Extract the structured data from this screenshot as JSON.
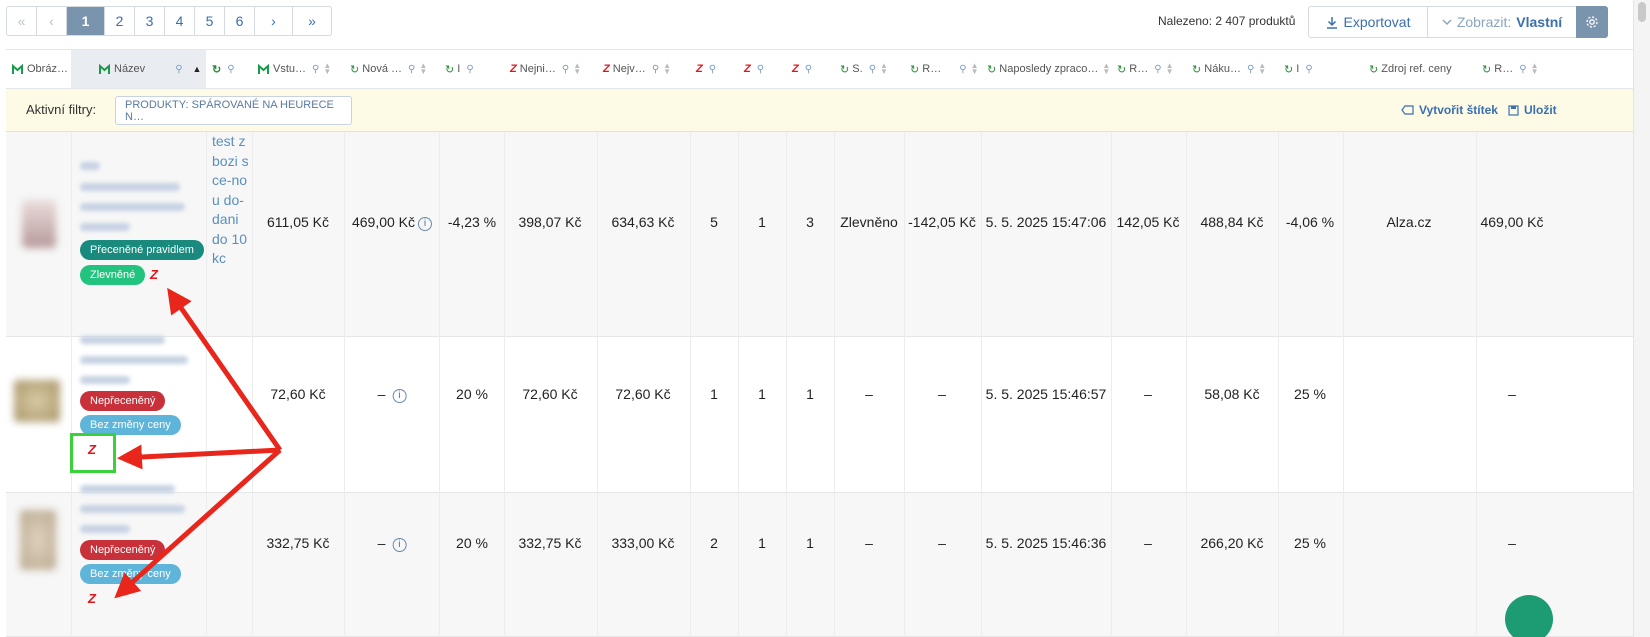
{
  "pagination": {
    "first": "«",
    "prev": "‹",
    "pages": [
      "1",
      "2",
      "3",
      "4",
      "5",
      "6"
    ],
    "next": "›",
    "last": "»",
    "current": "1"
  },
  "toolbar": {
    "found": "Nalezeno: 2 407 produktů",
    "export_label": "Exportovat",
    "view_prefix": "Zobrazit:",
    "view_value": "Vlastní"
  },
  "columns": [
    "Obráz…",
    "Název",
    "",
    "Vstu…",
    "Nová …",
    "I",
    "Nejni…",
    "Nejv…",
    "",
    "",
    "",
    "S.",
    "R…",
    "Naposledy zpraco…",
    "R…",
    "Náku…",
    "I",
    "Zdroj ref. ceny",
    "R…"
  ],
  "filters": {
    "label": "Aktivní filtry:",
    "chip": "PRODUKTY: SPÁROVANÉ NA HEURECE N…",
    "create_tag": "Vytvořit štítek",
    "save": "Uložit"
  },
  "rows": [
    {
      "tags": [
        "Přeceněné pravidlem",
        "Zlevněné"
      ],
      "note": "test zbozi s ce-nou do-dani do 10 kc",
      "cells": [
        "611,05 Kč",
        "469,00 Kč",
        "-4,23 %",
        "398,07 Kč",
        "634,63 Kč",
        "5",
        "1",
        "3",
        "Zlevněno",
        "-142,05 Kč",
        "5. 5. 2025 15:47:06",
        "142,05 Kč",
        "488,84 Kč",
        "-4,06 %",
        "Alza.cz",
        "469,00 Kč"
      ]
    },
    {
      "tags": [
        "Nepřeceněný",
        "Bez změny ceny"
      ],
      "note": "",
      "cells": [
        "72,60 Kč",
        "–",
        "20 %",
        "72,60 Kč",
        "72,60 Kč",
        "1",
        "1",
        "1",
        "–",
        "–",
        "5. 5. 2025 15:46:57",
        "–",
        "58,08 Kč",
        "25 %",
        "",
        "–"
      ]
    },
    {
      "tags": [
        "Nepřeceněný",
        "Bez změny ceny"
      ],
      "note": "",
      "cells": [
        "332,75 Kč",
        "–",
        "20 %",
        "332,75 Kč",
        "333,00 Kč",
        "2",
        "1",
        "1",
        "–",
        "–",
        "5. 5. 2025 15:46:36",
        "–",
        "266,20 Kč",
        "25 %",
        "",
        "–"
      ]
    }
  ],
  "icons": {
    "heureka": "green-m-icon",
    "zbozi": "red-z-icon",
    "shop": "green-arrow-icon"
  },
  "colors": {
    "accent": "#3a6fb0",
    "active_page": "#7b94ad",
    "tag_teal": "#1a8a7e",
    "tag_green": "#22c37e",
    "tag_red": "#c8313a",
    "tag_blue": "#5fb5d9",
    "annotation_arrow": "#e8261c",
    "highlight_box": "#3ad13a"
  }
}
